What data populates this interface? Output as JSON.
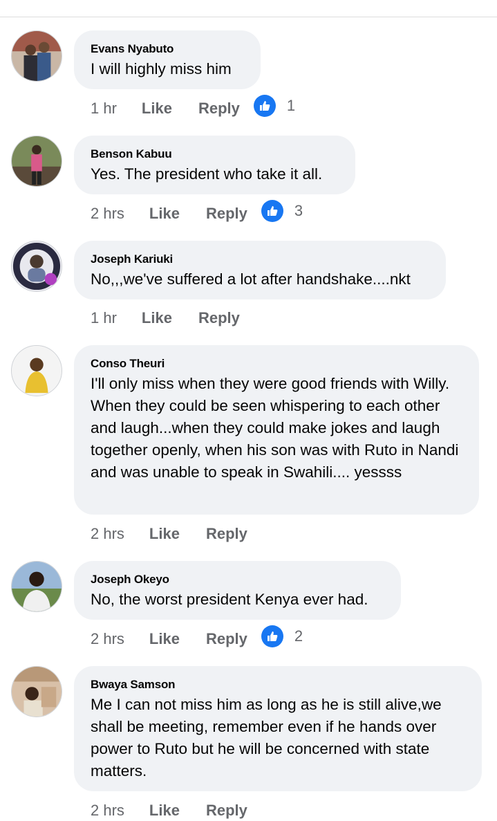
{
  "comments": [
    {
      "author": "Evans Nyabuto",
      "text": "I will highly miss him",
      "time": "1 hr",
      "like_label": "Like",
      "reply_label": "Reply",
      "reactions": "1"
    },
    {
      "author": "Benson Kabuu",
      "text": "Yes. The president who take it all.",
      "time": "2 hrs",
      "like_label": "Like",
      "reply_label": "Reply",
      "reactions": "3"
    },
    {
      "author": "Joseph Kariuki",
      "text": "No,,,we've suffered a lot after handshake....nkt",
      "time": "1 hr",
      "like_label": "Like",
      "reply_label": "Reply"
    },
    {
      "author": "Conso Theuri",
      "text": "I'll only miss when they were good friends with Willy. When they could be seen whispering to each other and laugh...when they could make jokes and laugh together openly, when his son was with Ruto in Nandi and was unable to speak in Swahili.... yessss",
      "time": "2 hrs",
      "like_label": "Like",
      "reply_label": "Reply"
    },
    {
      "author": "Joseph Okeyo",
      "text": "No, the worst president Kenya ever had.",
      "time": "2 hrs",
      "like_label": "Like",
      "reply_label": "Reply",
      "reactions": "2"
    },
    {
      "author": "Bwaya Samson",
      "text": "Me I can not miss him as long as he is still alive,we shall be meeting, remember even if he hands over power to Ruto but he will be concerned  with state matters.",
      "time": "2 hrs",
      "like_label": "Like",
      "reply_label": "Reply"
    }
  ],
  "colors": {
    "bubble": "#f0f2f5",
    "meta": "#65676b",
    "reaction": "#1877f2"
  },
  "icons": {
    "reaction": "thumbs-up-icon"
  }
}
